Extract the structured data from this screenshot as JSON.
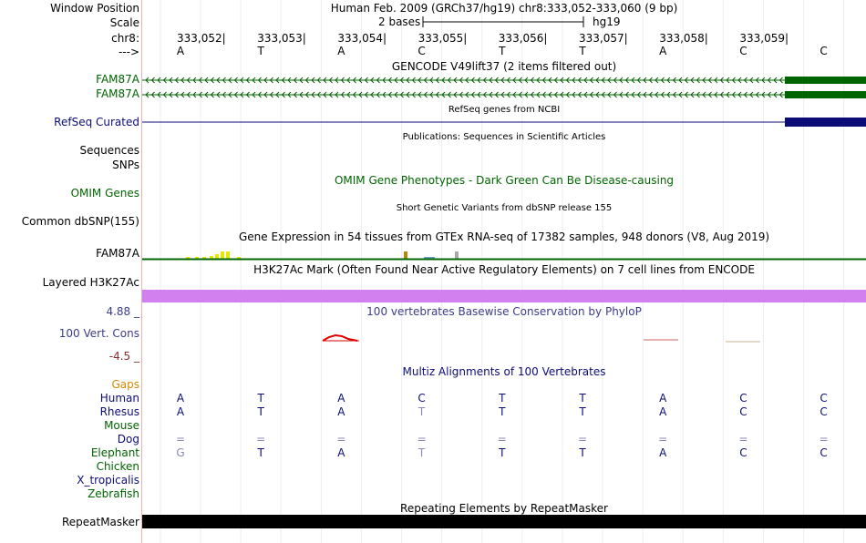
{
  "header": {
    "window_position_label": "Window Position",
    "scale_label": "Scale",
    "chrom_label": "chr8:",
    "strand_label": "--->",
    "assembly_text": "Human Feb. 2009 (GRCh37/hg19)   chr8:333,052-333,060 (9 bp)",
    "scale_text": "2 bases",
    "scale_assembly": "hg19",
    "positions": [
      "333,052",
      "333,053",
      "333,054",
      "333,055",
      "333,056",
      "333,057",
      "333,058",
      "333,059"
    ],
    "bases": [
      "A",
      "T",
      "A",
      "C",
      "T",
      "T",
      "A",
      "C",
      "C"
    ]
  },
  "tracks": {
    "gencode": {
      "title": "GENCODE V49lift37 (2 items filtered out)",
      "items": [
        "FAM87A",
        "FAM87A"
      ],
      "color": "#006400"
    },
    "refseq": {
      "title": "RefSeq genes from NCBI",
      "label": "RefSeq Curated",
      "color": "#0c0c78"
    },
    "publications": {
      "title": "Publications: Sequences in Scientific Articles",
      "labels": [
        "Sequences",
        "SNPs"
      ]
    },
    "omim": {
      "title": "OMIM Gene Phenotypes - Dark Green Can Be Disease-causing",
      "label": "OMIM Genes",
      "color": "#006400"
    },
    "dbsnp": {
      "title": "Short Genetic Variants from dbSNP release 155",
      "label": "Common dbSNP(155)"
    },
    "gtex": {
      "title": "Gene Expression in 54 tissues from GTEx RNA-seq of 17382 samples, 948 donors (V8, Aug 2019)",
      "label": "FAM87A"
    },
    "h3k27ac": {
      "title": "H3K27Ac Mark (Often Found Near Active Regulatory Elements) on 7 cell lines from ENCODE",
      "label": "Layered H3K27Ac",
      "color": "#d27ff0"
    },
    "conservation": {
      "title": "100 vertebrates Basewise Conservation by PhyloP",
      "label": "100 Vert. Cons",
      "max": "4.88 _",
      "min": "-4.5 _",
      "label_color": "#3c3c8c",
      "min_color": "#8b2a2a"
    },
    "multiz": {
      "title": "Multiz Alignments of 100 Vertebrates",
      "gaps_label": "Gaps",
      "gaps_color": "#d48a00",
      "species": [
        {
          "name": "Human",
          "color": "#0c0c78",
          "seq": [
            "A",
            "T",
            "A",
            "C",
            "T",
            "T",
            "A",
            "C",
            "C"
          ],
          "light": []
        },
        {
          "name": "Rhesus",
          "color": "#0c0c78",
          "seq": [
            "A",
            "T",
            "A",
            "T",
            "T",
            "T",
            "A",
            "C",
            "C"
          ],
          "light": [
            3
          ]
        },
        {
          "name": "Mouse",
          "color": "#006400",
          "seq": [],
          "light": []
        },
        {
          "name": "Dog",
          "color": "#0c0c78",
          "seq": [
            "=",
            "=",
            "=",
            "=",
            "=",
            "=",
            "=",
            "=",
            "="
          ],
          "light": [
            0,
            1,
            2,
            3,
            4,
            5,
            6,
            7,
            8
          ]
        },
        {
          "name": "Elephant",
          "color": "#006400",
          "seq": [
            "G",
            "T",
            "A",
            "T",
            "T",
            "T",
            "A",
            "C",
            "C"
          ],
          "light": [
            0,
            3
          ]
        },
        {
          "name": "Chicken",
          "color": "#006400",
          "seq": [],
          "light": []
        },
        {
          "name": "X_tropicalis",
          "color": "#0c0c78",
          "seq": [],
          "light": []
        },
        {
          "name": "Zebrafish",
          "color": "#006400",
          "seq": [],
          "light": []
        }
      ]
    },
    "repeatmasker": {
      "title": "Repeating Elements by RepeatMasker",
      "label": "RepeatMasker"
    }
  }
}
